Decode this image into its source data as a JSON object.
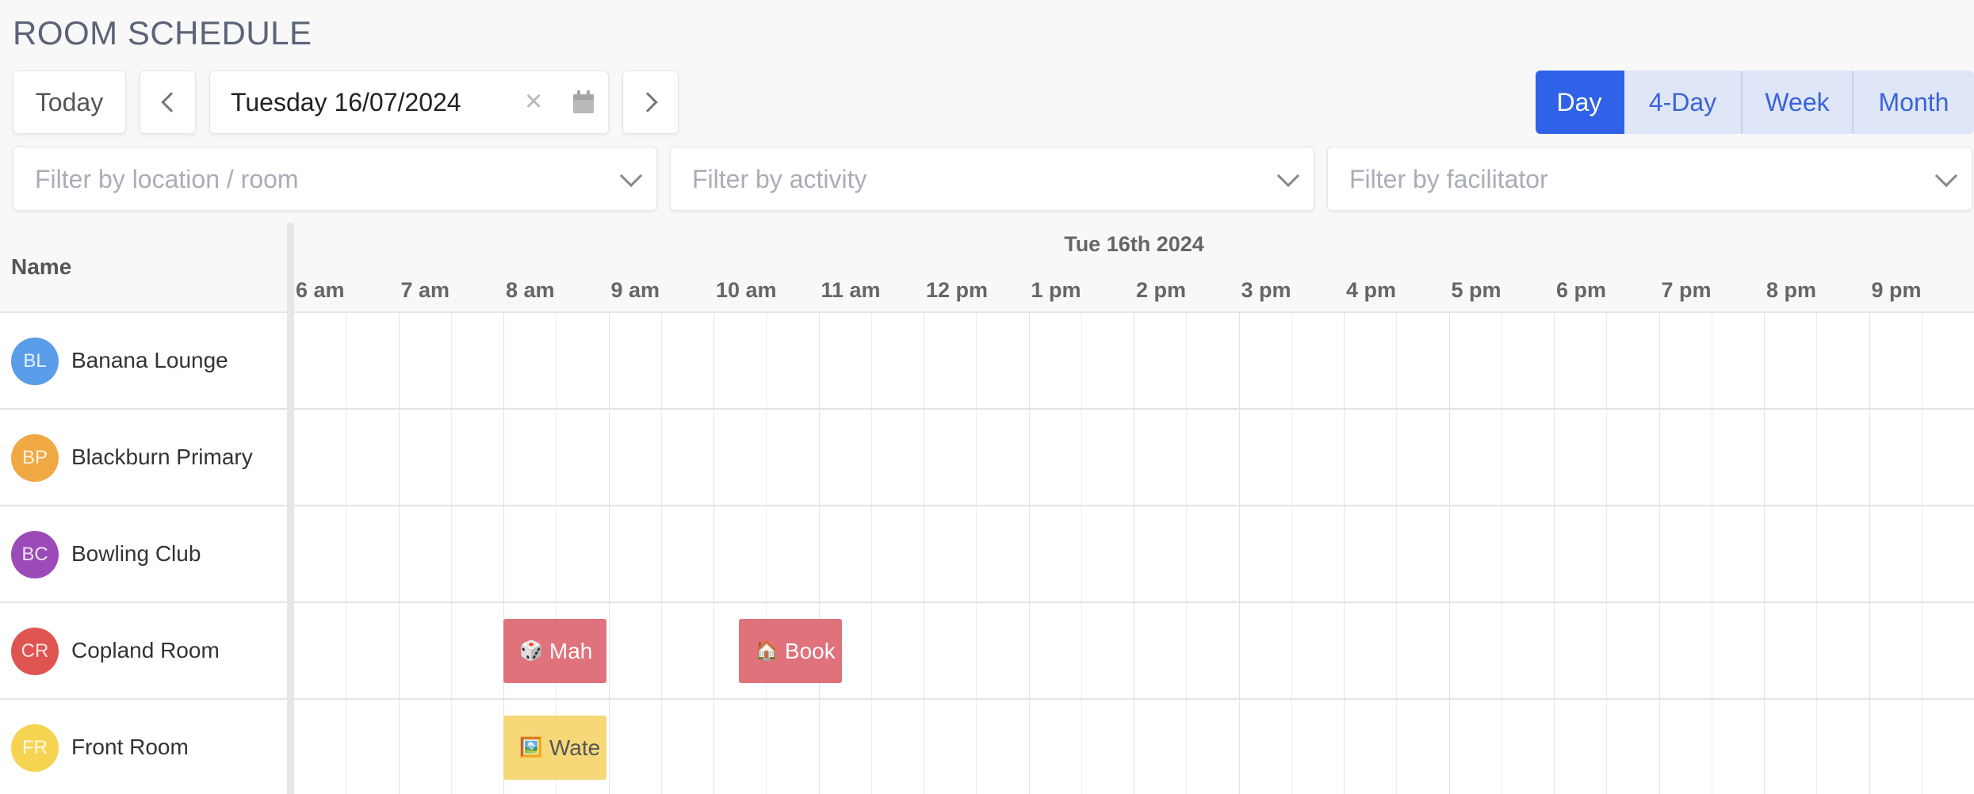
{
  "header": {
    "title": "ROOM SCHEDULE"
  },
  "toolbar": {
    "today_label": "Today",
    "date_value": "Tuesday 16/07/2024",
    "clear_symbol": "×",
    "views": [
      "Day",
      "4-Day",
      "Week",
      "Month"
    ],
    "active_view": "Day"
  },
  "filters": {
    "location_placeholder": "Filter by location / room",
    "activity_placeholder": "Filter by activity",
    "facilitator_placeholder": "Filter by facilitator"
  },
  "grid": {
    "name_header": "Name",
    "date_header": "Tue 16th 2024",
    "hours": [
      "6 am",
      "7 am",
      "8 am",
      "9 am",
      "10 am",
      "11 am",
      "12 pm",
      "1 pm",
      "2 pm",
      "3 pm",
      "4 pm",
      "5 pm",
      "6 pm",
      "7 pm",
      "8 pm",
      "9 pm"
    ]
  },
  "rooms": [
    {
      "initials": "BL",
      "name": "Banana Lounge",
      "color": "#5a9de8"
    },
    {
      "initials": "BP",
      "name": "Blackburn Primary",
      "color": "#f0a843"
    },
    {
      "initials": "BC",
      "name": "Bowling Club",
      "color": "#9b4bb8"
    },
    {
      "initials": "CR",
      "name": "Copland Room",
      "color": "#df5451"
    },
    {
      "initials": "FR",
      "name": "Front Room",
      "color": "#f6d452"
    }
  ],
  "events": [
    {
      "room": "Copland Room",
      "icon": "🎲",
      "label": "Mah",
      "color": "#df727b",
      "text_color": "#ffffff"
    },
    {
      "room": "Copland Room",
      "icon": "🏠",
      "label": "Book",
      "color": "#df727b",
      "text_color": "#ffffff"
    },
    {
      "room": "Front Room",
      "icon": "🖼️",
      "label": "Wate",
      "color": "#f6d878",
      "text_color": "#555555"
    }
  ],
  "colors": {
    "primary": "#2f62e8",
    "view_inactive_bg": "#dfe6f8"
  }
}
